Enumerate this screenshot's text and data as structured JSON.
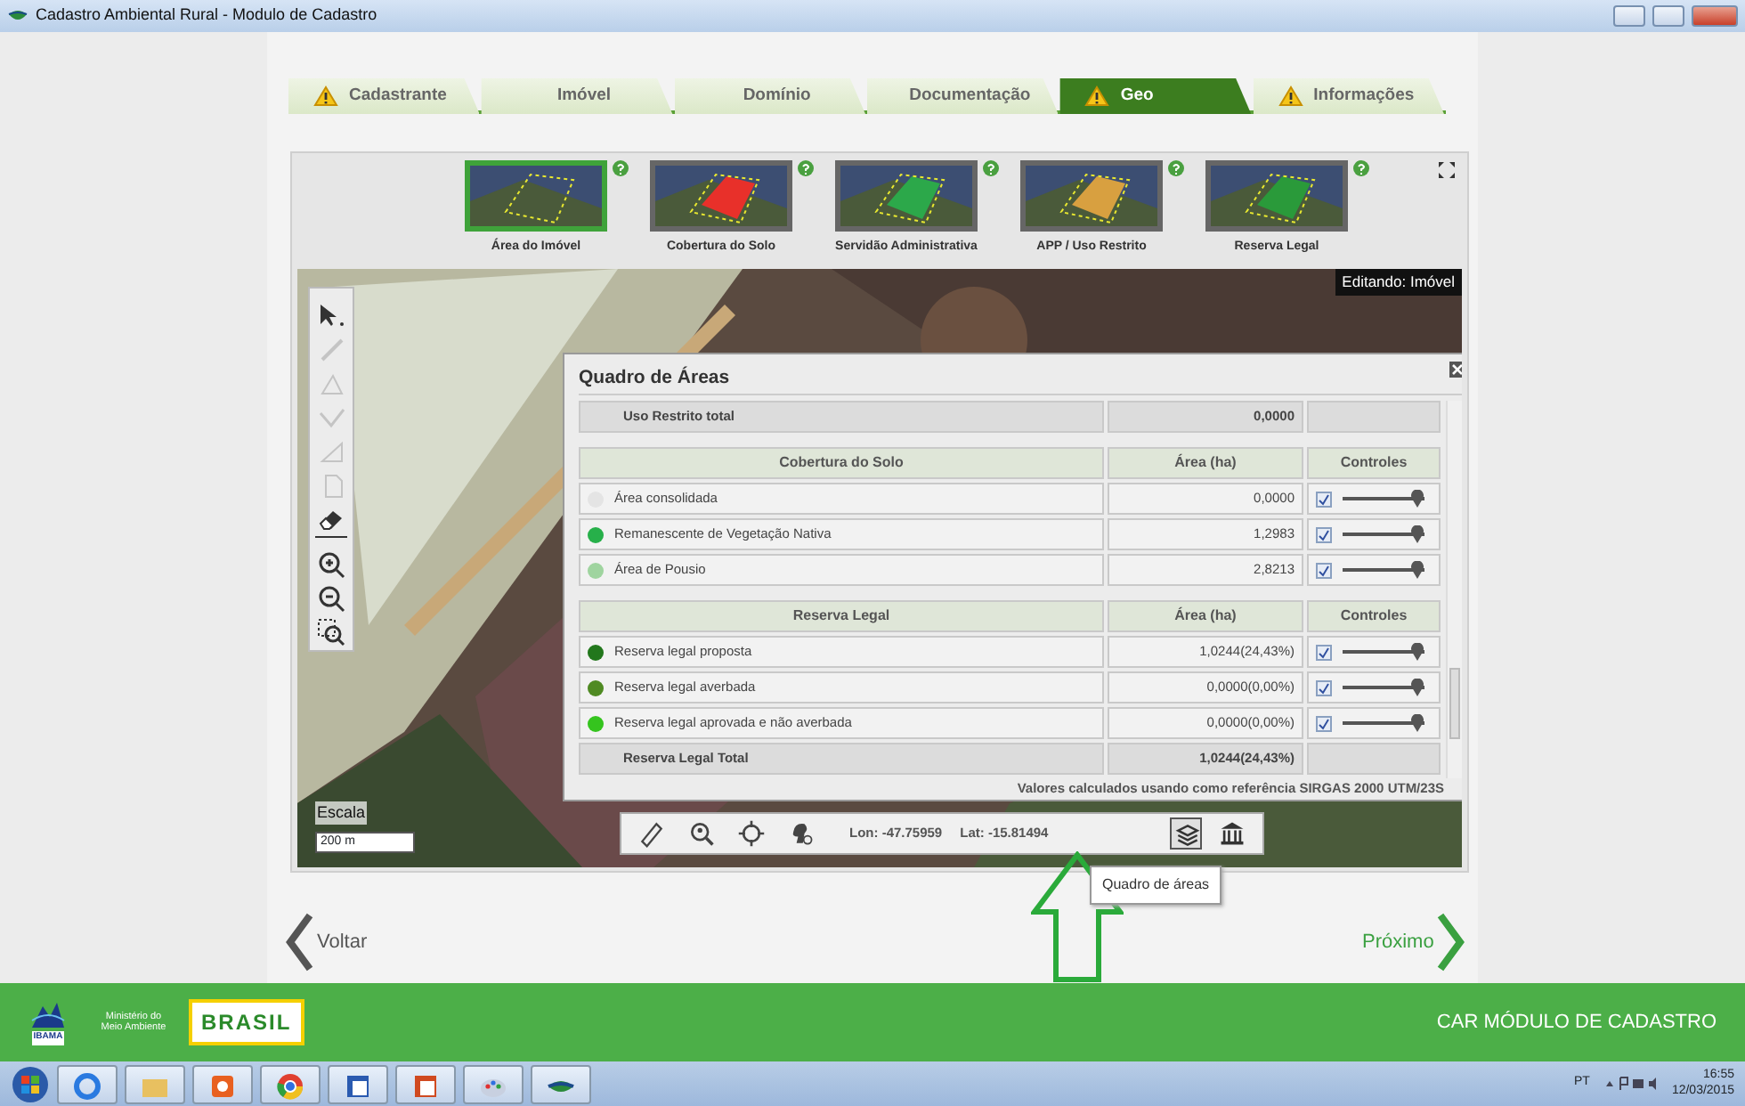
{
  "window": {
    "title": "Cadastro Ambiental Rural - Modulo de Cadastro"
  },
  "tabs": [
    {
      "label": "Cadastrante",
      "warning": true,
      "selected": false
    },
    {
      "label": "Imóvel",
      "warning": false,
      "selected": false
    },
    {
      "label": "Domínio",
      "warning": false,
      "selected": false
    },
    {
      "label": "Documentação",
      "warning": false,
      "selected": false
    },
    {
      "label": "Geo",
      "warning": true,
      "selected": true
    },
    {
      "label": "Informações",
      "warning": true,
      "selected": false
    }
  ],
  "layers": [
    {
      "label": "Área do Imóvel",
      "kind": "imovel",
      "selected": true
    },
    {
      "label": "Cobertura do Solo",
      "kind": "cobertura",
      "selected": false
    },
    {
      "label": "Servidão Administrativa",
      "kind": "servidao",
      "selected": false
    },
    {
      "label": "APP / Uso Restrito",
      "kind": "app",
      "selected": false
    },
    {
      "label": "Reserva Legal",
      "kind": "reserva",
      "selected": false
    }
  ],
  "map": {
    "editing_label": "Editando: Imóvel",
    "scale_title": "Escala",
    "scale_value": "200 m",
    "tools": [
      {
        "kind": "select",
        "disabled": false
      },
      {
        "kind": "line",
        "disabled": true
      },
      {
        "kind": "polygon",
        "disabled": true
      },
      {
        "kind": "path",
        "disabled": true
      },
      {
        "kind": "area",
        "disabled": true
      },
      {
        "kind": "import",
        "disabled": true
      },
      {
        "kind": "erase",
        "disabled": false
      },
      {
        "kind": "zoom-in",
        "disabled": false
      },
      {
        "kind": "zoom-out",
        "disabled": false
      },
      {
        "kind": "zoom-box",
        "disabled": false
      }
    ]
  },
  "dialog": {
    "title": "Quadro de Áreas",
    "sections": [
      {
        "kind": "total",
        "label": "Uso Restrito total",
        "area": "0,0000"
      },
      {
        "kind": "group",
        "headers": [
          "Cobertura do Solo",
          "Área (ha)",
          "Controles"
        ],
        "rows": [
          {
            "label": "Área consolidada",
            "area": "0,0000",
            "color": "#e4e4e4",
            "checked": true,
            "level": 1
          },
          {
            "label": "Remanescente de Vegetação Nativa",
            "area": "1,2983",
            "color": "#27b04a",
            "checked": true,
            "level": 1
          },
          {
            "label": "Área de Pousio",
            "area": "2,8213",
            "color": "#9fd49f",
            "checked": true,
            "level": 1
          }
        ]
      },
      {
        "kind": "group",
        "headers": [
          "Reserva Legal",
          "Área (ha)",
          "Controles"
        ],
        "rows": [
          {
            "label": "Reserva legal proposta",
            "area": "1,0244(24,43%)",
            "color": "#22771c",
            "checked": true,
            "level": 1
          },
          {
            "label": "Reserva legal averbada",
            "area": "0,0000(0,00%)",
            "color": "#4f8a22",
            "checked": true,
            "level": 1
          },
          {
            "label": "Reserva legal aprovada e não averbada",
            "area": "0,0000(0,00%)",
            "color": "#35c41e",
            "checked": true,
            "level": 1
          }
        ]
      },
      {
        "kind": "total",
        "label": "Reserva Legal Total",
        "area": "1,0244(24,43%)"
      }
    ],
    "note": "Valores calculados usando como referência SIRGAS 2000 UTM/23S"
  },
  "map_toolbar": {
    "tools": [
      {
        "kind": "ruler",
        "selected": false
      },
      {
        "kind": "locate",
        "selected": false
      },
      {
        "kind": "crosshair",
        "selected": false
      },
      {
        "kind": "profile",
        "selected": false
      }
    ],
    "lon": "Lon: -47.75959",
    "lat": "Lat: -15.81494",
    "end_tools": [
      {
        "kind": "layers",
        "selected": true
      },
      {
        "kind": "institution",
        "selected": false
      }
    ],
    "tooltip": "Quadro de áreas"
  },
  "nav": {
    "back": "Voltar",
    "next": "Próximo"
  },
  "footer": {
    "ibama": "IBAMA",
    "ministry": "Ministério do Meio Ambiente",
    "brasil": "BRASIL",
    "app_name": "CAR MÓDULO DE CADASTRO"
  },
  "taskbar": {
    "apps": [
      {
        "kind": "ie"
      },
      {
        "kind": "folder"
      },
      {
        "kind": "media"
      },
      {
        "kind": "chrome"
      },
      {
        "kind": "word"
      },
      {
        "kind": "powerpoint"
      },
      {
        "kind": "paint"
      },
      {
        "kind": "car"
      }
    ],
    "language": "PT",
    "time": "16:55",
    "date": "12/03/2015"
  }
}
